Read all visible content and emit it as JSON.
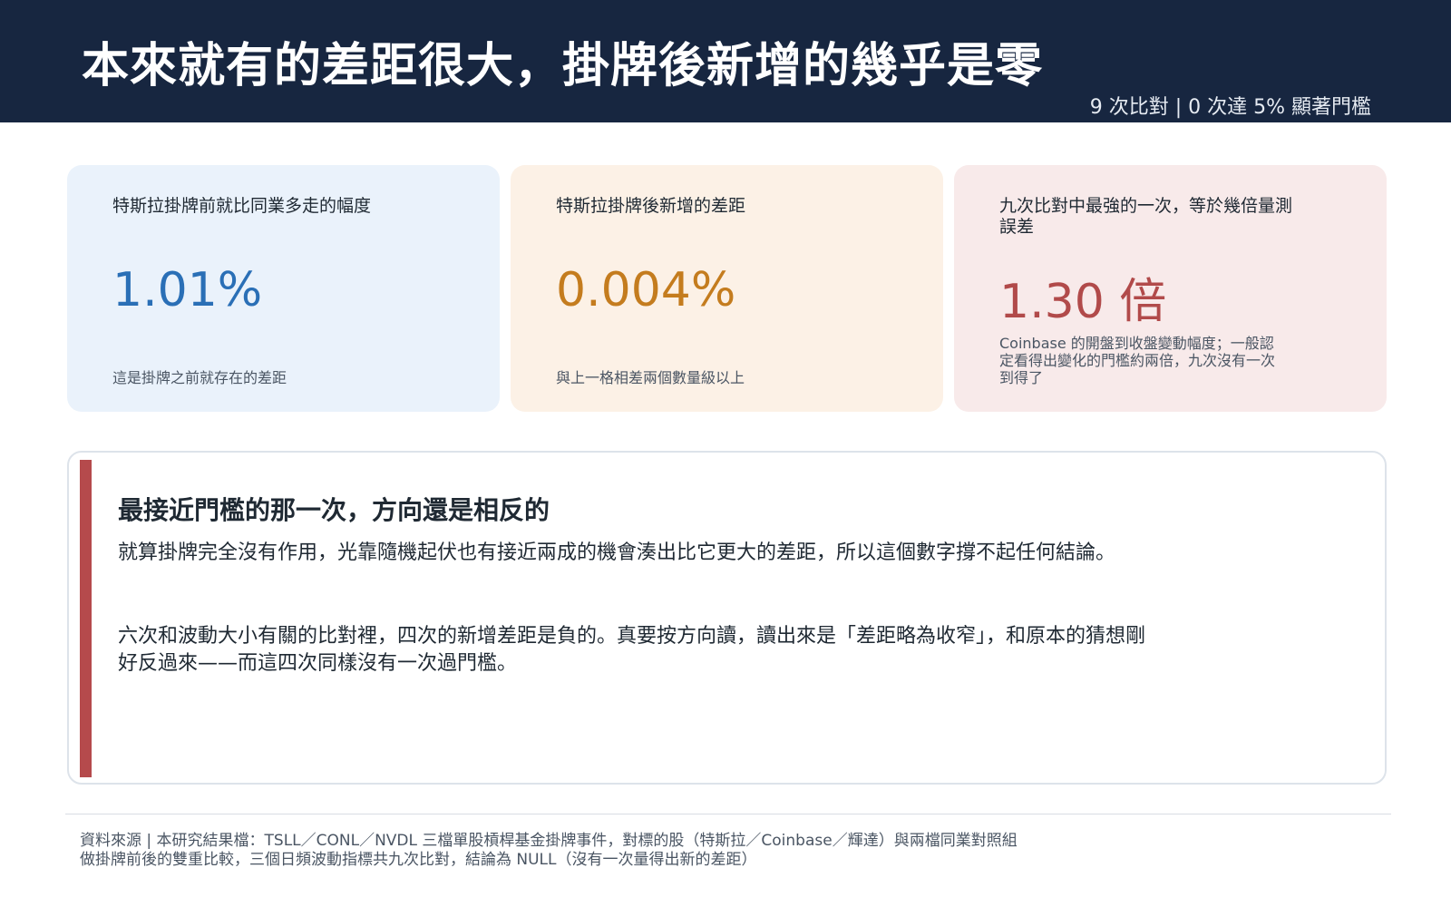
{
  "header": {
    "title": "本來就有的差距很大，掛牌後新增的幾乎是零",
    "subtitle": "9 次比對 | 0 次達 5% 顯著門檻"
  },
  "cards": [
    {
      "label": "特斯拉掛牌前就比同業多走的幅度",
      "value": "1.01%",
      "note": "這是掛牌之前就存在的差距"
    },
    {
      "label": "特斯拉掛牌後新增的差距",
      "value": "0.004%",
      "note": "與上一格相差兩個數量級以上"
    },
    {
      "label": "九次比對中最強的一次，等於幾倍量測誤差",
      "value": "1.30 倍",
      "note": "Coinbase 的開盤到收盤變動幅度；一般認定看得出變化的門檻約兩倍，九次沒有一次到得了"
    }
  ],
  "panel": {
    "heading": "最接近門檻的那一次，方向還是相反的",
    "paragraph1": "就算掛牌完全沒有作用，光靠隨機起伏也有接近兩成的機會湊出比它更大的差距，所以這個數字撐不起任何結論。",
    "paragraph2": "六次和波動大小有關的比對裡，四次的新增差距是負的。真要按方向讀，讀出來是「差距略為收窄」，和原本的猜想剛好反過來——而這四次同樣沒有一次過門檻。"
  },
  "footer": {
    "source": "資料來源 | 本研究結果檔：TSLL／CONL／NVDL 三檔單股槓桿基金掛牌事件，對標的股（特斯拉／Coinbase／輝達）與兩檔同業對照組做掛牌前後的雙重比較，三個日頻波動指標共九次比對，結論為 NULL（沒有一次量得出新的差距）"
  },
  "colors": {
    "header_bg": "#172640",
    "blue_value": "#2a6fb6",
    "amber_value": "#c47c1e",
    "red_value": "#b14a4a",
    "accent_bar": "#b54a4c"
  }
}
